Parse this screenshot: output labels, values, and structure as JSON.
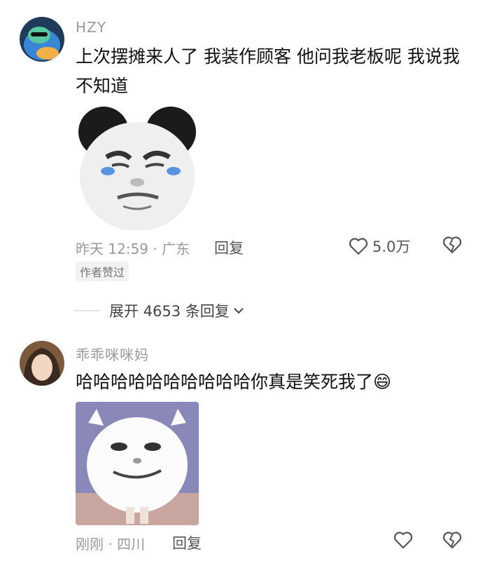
{
  "comments": [
    {
      "username": "HZY",
      "text": "上次摆摊来人了 我装作顾客 他问我老板呢 我说我不知道",
      "time_location": "昨天 12:59 · 广东",
      "reply_label": "回复",
      "like_count": "5.0万",
      "badge": "作者赞过",
      "expand_label": "展开 4653 条回复"
    },
    {
      "username": "乖乖咪咪妈",
      "text": "哈哈哈哈哈哈哈哈哈哈你真是笑死我了",
      "emoji": "😄",
      "time_location": "刚刚 · 四川",
      "reply_label": "回复"
    }
  ]
}
